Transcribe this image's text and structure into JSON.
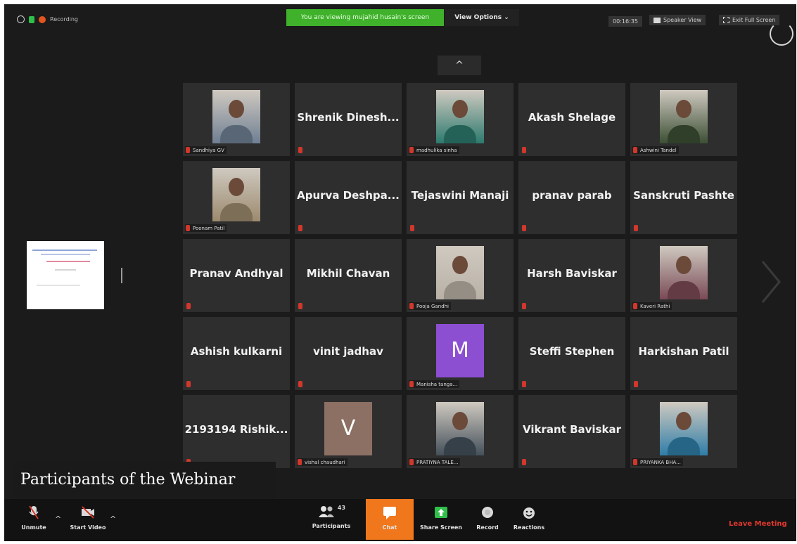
{
  "colors": {
    "background": "#1b1b1b",
    "tile": "#2e2e2e",
    "banner_green": "#3fb12b",
    "chat_orange": "#f0771c",
    "leave_red": "#e0382e",
    "muted_red": "#d2372b"
  },
  "topbar": {
    "recording_label": "Recording",
    "viewing_banner": "You are viewing mujahid husain's screen",
    "view_options_label": "View Options ⌄",
    "timer": "00:16:35",
    "speaker_view_label": "Speaker View",
    "exit_fullscreen_label": "Exit Full Screen"
  },
  "icons": {
    "info": "info-icon",
    "lock": "lock-icon",
    "recording": "recording-dot-icon",
    "speaker_view": "speaker-view-icon",
    "exit_fullscreen": "exit-fullscreen-icon",
    "up": "chevron-up-icon",
    "next": "chevron-right-icon",
    "muted": "muted-mic-icon"
  },
  "gallery": {
    "up_arrow": "^",
    "tiles": [
      {
        "type": "photo",
        "label": "Sandhiya GV",
        "photo_color": "#6f7f94"
      },
      {
        "type": "name",
        "name": "Shrenik  Dinesh..."
      },
      {
        "type": "photo",
        "label": "madhulika sinha",
        "photo_color": "#2d7a6e"
      },
      {
        "type": "name",
        "name": "Akash Shelage"
      },
      {
        "type": "photo",
        "label": "Ashwini Tandel",
        "photo_color": "#3c4f34"
      },
      {
        "type": "photo",
        "label": "Poonam Patil",
        "photo_color": "#9c8a6e"
      },
      {
        "type": "name",
        "name": "Apurva  Deshpa..."
      },
      {
        "type": "name",
        "name": "Tejaswini Manaji"
      },
      {
        "type": "name",
        "name": "pranav parab"
      },
      {
        "type": "name",
        "name": "Sanskruti Pashte"
      },
      {
        "type": "name",
        "name": "Pranav Andhyal"
      },
      {
        "type": "name",
        "name": "Mikhil Chavan"
      },
      {
        "type": "photo",
        "label": "Pooja Gandhi",
        "photo_color": "#b9b1a6"
      },
      {
        "type": "name",
        "name": "Harsh Baviskar"
      },
      {
        "type": "photo",
        "label": "Kaveri Rathi",
        "photo_color": "#7a4a56"
      },
      {
        "type": "name",
        "name": "Ashish kulkarni"
      },
      {
        "type": "name",
        "name": "vinit jadhav"
      },
      {
        "type": "avatar",
        "letter": "M",
        "avatar_color": "#8c4fd1",
        "label": "Manisha tanga..."
      },
      {
        "type": "name",
        "name": "Steffi Stephen"
      },
      {
        "type": "name",
        "name": "Harkishan Patil"
      },
      {
        "type": "name",
        "name": "2193194  Rishik..."
      },
      {
        "type": "avatar",
        "letter": "V",
        "avatar_color": "#8b7063",
        "label": "vishal chaudhari"
      },
      {
        "type": "photo",
        "label": "PRATIYNA TALE...",
        "photo_color": "#44505a"
      },
      {
        "type": "name",
        "name": "Vikrant Baviskar"
      },
      {
        "type": "photo",
        "label": "PRIYANKA BHA...",
        "photo_color": "#2f7ea8"
      }
    ]
  },
  "caption": "Participants of the Webinar",
  "toolbar": {
    "unmute": "Unmute",
    "start_video": "Start Video",
    "participants": "Participants",
    "participants_count": "43",
    "chat": "Chat",
    "share_screen": "Share Screen",
    "record": "Record",
    "reactions": "Reactions",
    "leave": "Leave Meeting"
  }
}
